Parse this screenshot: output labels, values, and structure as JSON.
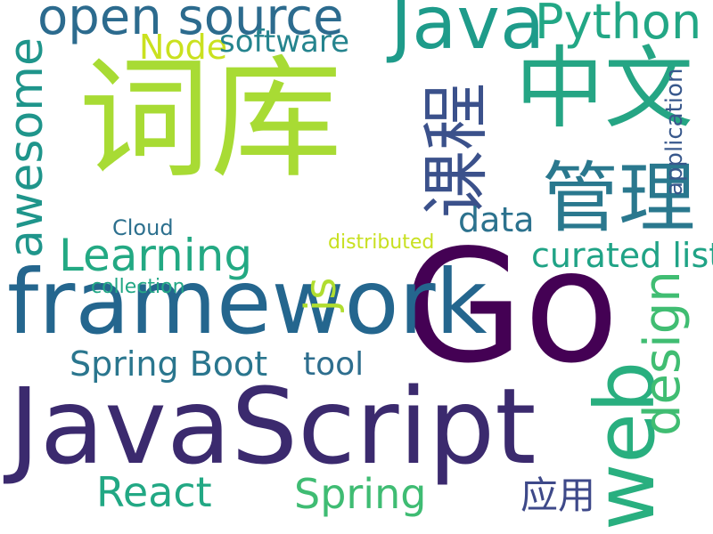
{
  "words": [
    {
      "text": "Go",
      "color": "#440154"
    },
    {
      "text": "JavaScript",
      "color": "#3b2a6e"
    },
    {
      "text": "词库",
      "color": "#a8db34"
    },
    {
      "text": "framework",
      "color": "#24668e"
    },
    {
      "text": "Java",
      "color": "#1e9b8a"
    },
    {
      "text": "中文",
      "color": "#25a584"
    },
    {
      "text": "open source",
      "color": "#2c6b8e"
    },
    {
      "text": "web",
      "color": "#29af7f"
    },
    {
      "text": "管理",
      "color": "#2a788e"
    },
    {
      "text": "课程",
      "color": "#3b518b"
    },
    {
      "text": "Python",
      "color": "#22a785"
    },
    {
      "text": "Learning",
      "color": "#23a983"
    },
    {
      "text": "awesome",
      "color": "#1f958b"
    },
    {
      "text": "Spring",
      "color": "#3fbc73"
    },
    {
      "text": "React",
      "color": "#22a884"
    },
    {
      "text": "design",
      "color": "#40bd72"
    },
    {
      "text": "js",
      "color": "#b0dd2f"
    },
    {
      "text": "Node",
      "color": "#cae11f"
    },
    {
      "text": "software",
      "color": "#25848e"
    },
    {
      "text": "Spring Boot",
      "color": "#2a768e"
    },
    {
      "text": "curated list",
      "color": "#20a386"
    },
    {
      "text": "data",
      "color": "#2c728e"
    },
    {
      "text": "tool",
      "color": "#2e6e8e"
    },
    {
      "text": "application",
      "color": "#38588c"
    },
    {
      "text": "应用",
      "color": "#3e4989"
    },
    {
      "text": "Cloud",
      "color": "#2d708e"
    },
    {
      "text": "distributed",
      "color": "#c8e020"
    },
    {
      "text": "collection",
      "color": "#22a785"
    }
  ]
}
